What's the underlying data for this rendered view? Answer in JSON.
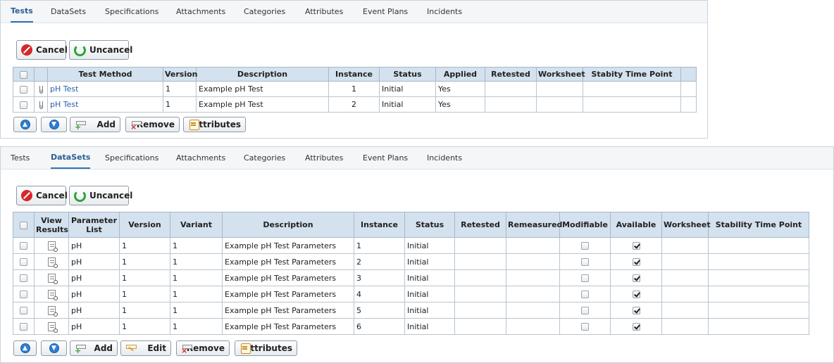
{
  "panel1": {
    "tabs": [
      "Tests",
      "DataSets",
      "Specifications",
      "Attachments",
      "Categories",
      "Attributes",
      "Event Plans",
      "Incidents"
    ],
    "active_tab": "Tests",
    "toolbar": {
      "cancel": "Cancel",
      "uncancel": "Uncancel"
    },
    "columns": [
      "",
      "",
      "Test Method",
      "Version",
      "Description",
      "Instance",
      "Status",
      "Applied",
      "Retested",
      "Worksheet",
      "Stabity Time Point",
      ""
    ],
    "rows": [
      {
        "test_method": "pH Test",
        "version": "1",
        "description": "Example pH Test",
        "instance": "1",
        "status": "Initial",
        "applied": "Yes",
        "retested": "",
        "worksheet": "",
        "stability": ""
      },
      {
        "test_method": "pH Test",
        "version": "1",
        "description": "Example pH Test",
        "instance": "2",
        "status": "Initial",
        "applied": "Yes",
        "retested": "",
        "worksheet": "",
        "stability": ""
      }
    ],
    "bottom_buttons": {
      "add": "Add",
      "remove": "Remove",
      "attributes": "Attributes"
    }
  },
  "panel2": {
    "tabs": [
      "Tests",
      "DataSets",
      "Specifications",
      "Attachments",
      "Categories",
      "Attributes",
      "Event Plans",
      "Incidents"
    ],
    "active_tab": "DataSets",
    "toolbar": {
      "cancel": "Cancel",
      "uncancel": "Uncancel"
    },
    "columns": [
      "",
      "View Results",
      "Parameter List",
      "Version",
      "Variant",
      "Description",
      "Instance",
      "Status",
      "Retested",
      "Remeasured",
      "Modifiable",
      "Available",
      "Worksheet",
      "Stability Time Point"
    ],
    "rows": [
      {
        "parameter_list": "pH",
        "version": "1",
        "variant": "1",
        "description": "Example pH Test Parameters",
        "instance": "1",
        "status": "Initial",
        "modifiable": false,
        "available": true
      },
      {
        "parameter_list": "pH",
        "version": "1",
        "variant": "1",
        "description": "Example pH Test Parameters",
        "instance": "2",
        "status": "Initial",
        "modifiable": false,
        "available": true
      },
      {
        "parameter_list": "pH",
        "version": "1",
        "variant": "1",
        "description": "Example pH Test Parameters",
        "instance": "3",
        "status": "Initial",
        "modifiable": false,
        "available": true
      },
      {
        "parameter_list": "pH",
        "version": "1",
        "variant": "1",
        "description": "Example pH Test Parameters",
        "instance": "4",
        "status": "Initial",
        "modifiable": false,
        "available": true
      },
      {
        "parameter_list": "pH",
        "version": "1",
        "variant": "1",
        "description": "Example pH Test Parameters",
        "instance": "5",
        "status": "Initial",
        "modifiable": false,
        "available": true
      },
      {
        "parameter_list": "pH",
        "version": "1",
        "variant": "1",
        "description": "Example pH Test Parameters",
        "instance": "6",
        "status": "Initial",
        "modifiable": false,
        "available": true
      }
    ],
    "bottom_buttons": {
      "add": "Add",
      "edit": "Edit",
      "remove": "Remove",
      "attributes": "Attributes"
    }
  },
  "icons": [
    "cancel-icon",
    "uncancel-icon",
    "move-up-icon",
    "move-down-icon",
    "add-icon",
    "edit-icon",
    "remove-icon",
    "attributes-icon",
    "test-tube-icon",
    "view-results-icon"
  ]
}
